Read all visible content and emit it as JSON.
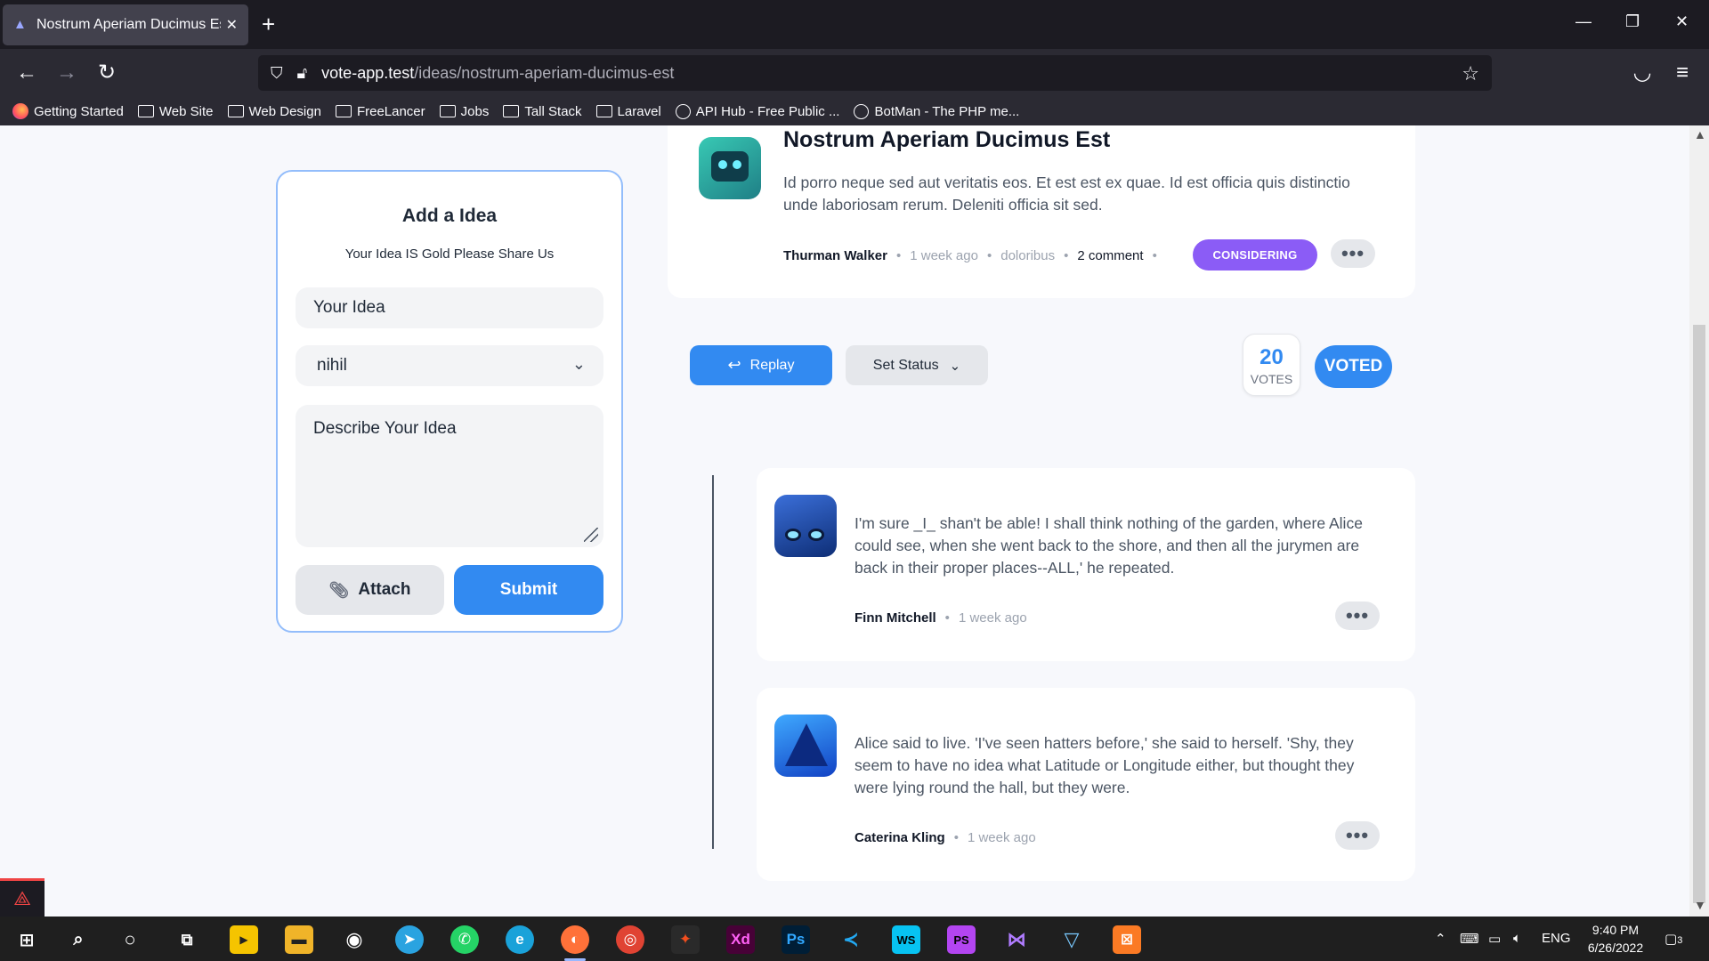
{
  "browser": {
    "tab_title": "Nostrum Aperiam Ducimus Est",
    "url_host": "vote-app.test",
    "url_path": "/ideas/nostrum-aperiam-ducimus-est",
    "bookmarks": [
      {
        "label": "Getting Started",
        "icon": "firefox-icon"
      },
      {
        "label": "Web Site",
        "icon": "folder-icon"
      },
      {
        "label": "Web Design",
        "icon": "folder-icon"
      },
      {
        "label": "FreeLancer",
        "icon": "folder-icon"
      },
      {
        "label": "Jobs",
        "icon": "folder-icon"
      },
      {
        "label": "Tall Stack",
        "icon": "folder-icon"
      },
      {
        "label": "Laravel",
        "icon": "folder-icon"
      },
      {
        "label": "API Hub - Free Public ...",
        "icon": "globe-icon"
      },
      {
        "label": "BotMan - The PHP me...",
        "icon": "globe-icon"
      }
    ]
  },
  "add_idea": {
    "heading": "Add a Idea",
    "subheading": "Your Idea IS Gold Please Share Us",
    "title_placeholder": "Your Idea",
    "category_value": "nihil",
    "description_placeholder": "Describe Your Idea",
    "attach_label": "Attach",
    "submit_label": "Submit"
  },
  "idea": {
    "title": "Nostrum Aperiam Ducimus Est",
    "body": "Id porro neque sed aut veritatis eos. Et est est ex quae. Id est officia quis distinctio unde laboriosam rerum. Deleniti officia sit sed.",
    "author": "Thurman Walker",
    "time": "1 week ago",
    "category": "doloribus",
    "comments": "2 comment",
    "status": "CONSIDERING"
  },
  "actions": {
    "replay_label": "Replay",
    "set_status_label": "Set Status",
    "votes_count": "20",
    "votes_label": "VOTES",
    "voted_label": "VOTED"
  },
  "comments": [
    {
      "text": "I'm sure _I_ shan't be able! I shall think nothing of the garden, where Alice could see, when she went back to the shore, and then all the jurymen are back in their proper places--ALL,' he repeated.",
      "author": "Finn Mitchell",
      "time": "1 week ago"
    },
    {
      "text": "Alice said to live. 'I've seen hatters before,' she said to herself. 'Shy, they seem to have no idea what Latitude or Longitude either, but thought they were lying round the hall, but they were.",
      "author": "Caterina Kling",
      "time": "1 week ago"
    }
  ],
  "taskbar": {
    "time": "9:40 PM",
    "date": "6/26/2022",
    "language": "ENG",
    "notifications": "3"
  },
  "colors": {
    "primary": "#328af1",
    "status_considering": "#8b5cf6",
    "form_border": "#93bdfb"
  }
}
